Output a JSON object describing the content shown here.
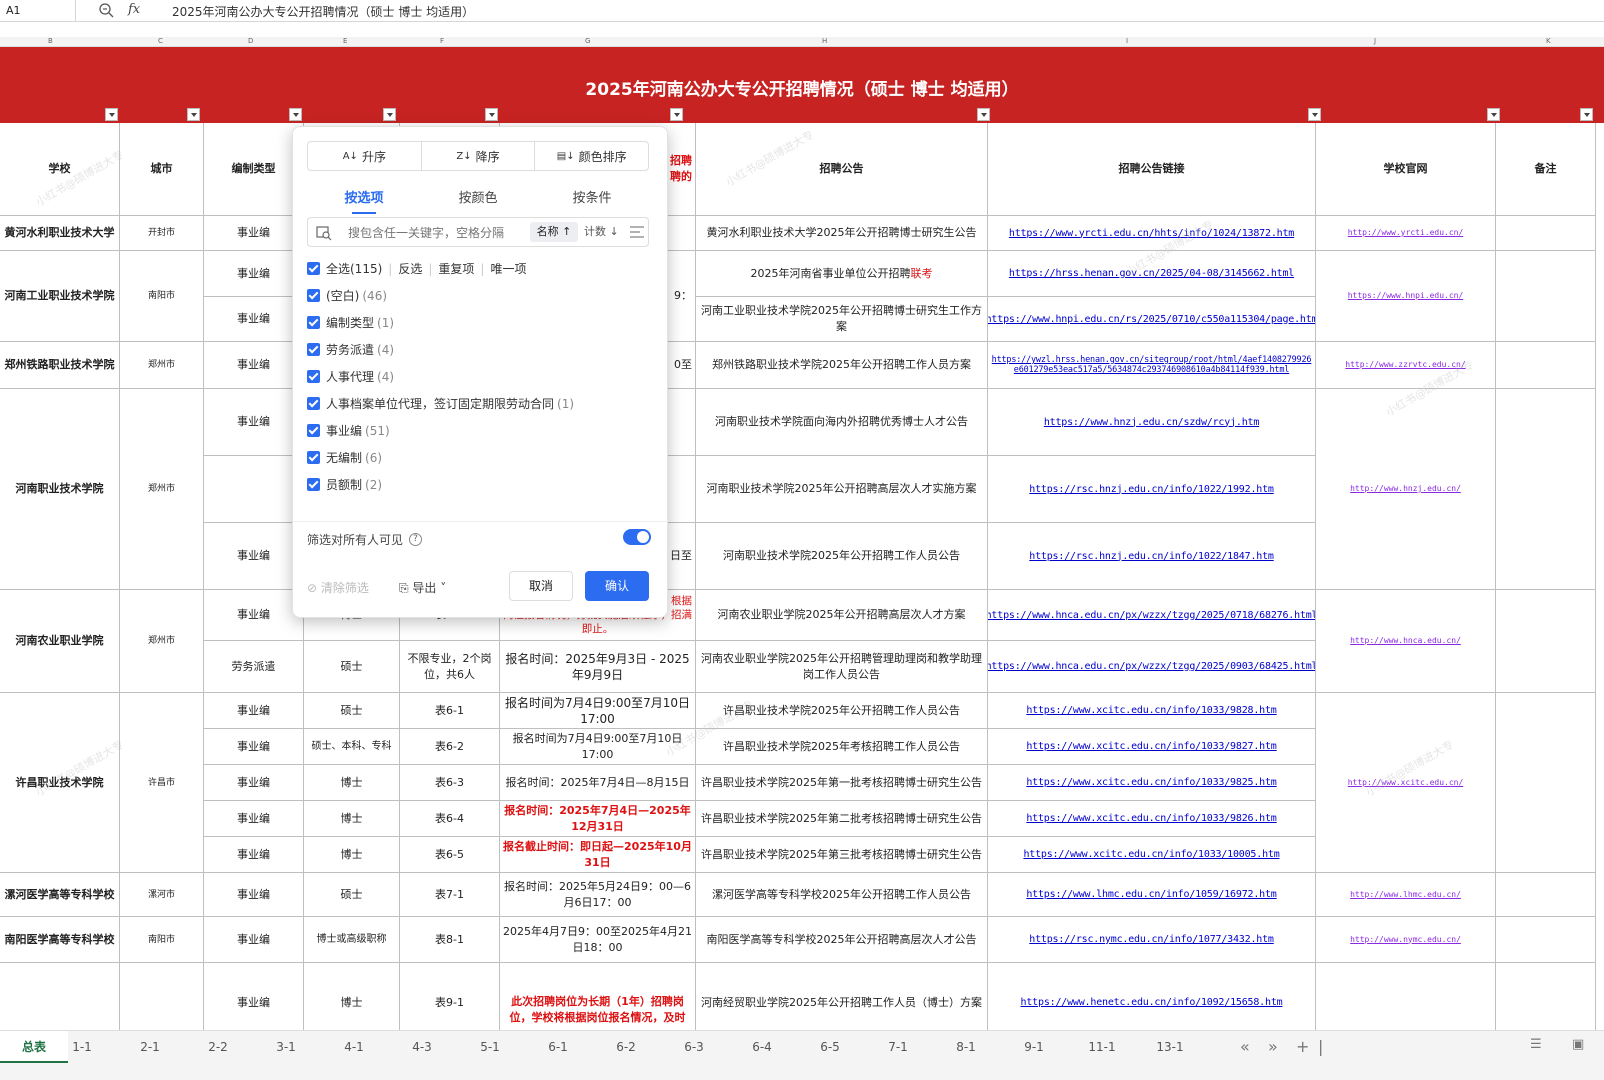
{
  "formula_bar": {
    "cell_ref": "A1",
    "fx_label": "fx",
    "content": "2025年河南公办大专公开招聘情况（硕士  博士 均适用）"
  },
  "column_letters": [
    "B",
    "C",
    "D",
    "E",
    "F",
    "G",
    "H",
    "I",
    "J",
    "K"
  ],
  "banner_title": "2025年河南公办大专公开招聘情况（硕士  博士 均适用）",
  "headers": {
    "school": "学校",
    "city": "城市",
    "type": "编制类型",
    "note_header_fragment": "招聘\n聘的",
    "announce": "招聘公告",
    "link": "招聘公告链接",
    "site": "学校官网",
    "remark": "备注"
  },
  "rows": [
    {
      "school": "黄河水利职业技术大学",
      "city": "开封市",
      "type": "事业编",
      "degree": "",
      "table": "",
      "note": "",
      "announce": "黄河水利职业技术大学2025年公开招聘博士研究生公告",
      "link": "https://www.yrcti.edu.cn/hhts/info/1024/13872.htm",
      "site": "http://www.yrcti.edu.cn/"
    },
    {
      "school": "河南工业职业技术学院",
      "city": "南阳市",
      "type": "事业编",
      "note": "9：",
      "announce": "2025年河南省事业单位公开招聘",
      "announce_red": "联考",
      "link": "https://hrss.henan.gov.cn/2025/04-08/3145662.html",
      "site": "https://www.hnpi.edu.cn/"
    },
    {
      "type": "事业编",
      "announce": "河南工业职业技术学院2025年公开招聘博士研究生工作方案",
      "link": "https://www.hnpi.edu.cn/rs/2025/0710/c550a115304/page.htm"
    },
    {
      "school": "郑州铁路职业技术学院",
      "city": "郑州市",
      "type": "事业编",
      "note": "0至",
      "announce": "郑州铁路职业技术学院2025年公开招聘工作人员方案",
      "link": "https://ywzl.hrss.henan.gov.cn/sitegroup/root/html/4aef1408279926e601279e53eac517a5/5634874c293746908610a4b84114f939.html",
      "site": "http://www.zzrvtc.edu.cn/"
    },
    {
      "school": "河南职业技术学院",
      "city": "郑州市",
      "type": "事业编",
      "announce": "河南职业技术学院面向海内外招聘优秀博士人才公告",
      "link": "https://www.hnzj.edu.cn/szdw/rcyj.htm",
      "site": "http://www.hnzj.edu.cn/"
    },
    {
      "type": "",
      "announce": "河南职业技术学院2025年公开招聘高层次人才实施方案",
      "link": "https://rsc.hnzj.edu.cn/info/1022/1992.htm"
    },
    {
      "type": "事业编",
      "note": "日至",
      "announce": "河南职业技术学院2025年公开招聘工作人员公告",
      "link": "https://rsc.hnzj.edu.cn/info/1022/1847.htm"
    },
    {
      "school": "河南农业职业学院",
      "city": "郑州市",
      "type": "事业编",
      "degree": "博士",
      "table": "表5-1",
      "note": "岗位报名情况，分批实施后续程序，招满即止。",
      "note_prefix": "根据",
      "announce": "河南农业职业学院2025年公开招聘高层次人才方案",
      "link": "https://www.hnca.edu.cn/px/wzzx/tzgg/2025/0718/68276.html",
      "site": "http://www.hnca.edu.cn/"
    },
    {
      "type": "劳务派遣",
      "degree": "硕士",
      "table": "不限专业，2个岗位，共6人",
      "note": "报名时间：2025年9月3日 - 2025年9月9日",
      "announce": "河南农业职业学院2025年公开招聘管理助理岗和教学助理岗工作人员公告",
      "link": "https://www.hnca.edu.cn/px/wzzx/tzgg/2025/0903/68425.html"
    },
    {
      "school": "许昌职业技术学院",
      "city": "许昌市",
      "type": "事业编",
      "degree": "硕士",
      "table": "表6-1",
      "note": "报名时间为7月4日9:00至7月10日17:00",
      "announce": "许昌职业技术学院2025年公开招聘工作人员公告",
      "link": "https://www.xcitc.edu.cn/info/1033/9828.htm",
      "site": "http://www.xcitc.edu.cn/"
    },
    {
      "type": "事业编",
      "degree": "硕士、本科、专科",
      "table": "表6-2",
      "note": "报名时间为7月4日9:00至7月10日17:00",
      "announce": "许昌职业技术学院2025年考核招聘工作人员公告",
      "link": "https://www.xcitc.edu.cn/info/1033/9827.htm"
    },
    {
      "type": "事业编",
      "degree": "博士",
      "table": "表6-3",
      "note": "报名时间：2025年7月4日—8月15日",
      "announce": "许昌职业技术学院2025年第一批考核招聘博士研究生公告",
      "link": "https://www.xcitc.edu.cn/info/1033/9825.htm"
    },
    {
      "type": "事业编",
      "degree": "博士",
      "table": "表6-4",
      "note": "报名时间：2025年7月4日—2025年12月31日",
      "red": true,
      "announce": "许昌职业技术学院2025年第二批考核招聘博士研究生公告",
      "link": "https://www.xcitc.edu.cn/info/1033/9826.htm"
    },
    {
      "type": "事业编",
      "degree": "博士",
      "table": "表6-5",
      "note": "报名截止时间：即日起—2025年10月31日",
      "red": true,
      "announce": "许昌职业技术学院2025年第三批考核招聘博士研究生公告",
      "link": "https://www.xcitc.edu.cn/info/1033/10005.htm"
    },
    {
      "school": "漯河医学高等专科学校",
      "city": "漯河市",
      "type": "事业编",
      "degree": "硕士",
      "table": "表7-1",
      "note": "报名时间：2025年5月24日9：00—6月6日17：00",
      "announce": "漯河医学高等专科学校2025年公开招聘工作人员公告",
      "link": "https://www.lhmc.edu.cn/info/1059/16972.htm",
      "site": "http://www.lhmc.edu.cn/"
    },
    {
      "school": "南阳医学高等专科学校",
      "city": "南阳市",
      "type": "事业编",
      "degree": "博士或高级职称",
      "table": "表8-1",
      "note": "2025年4月7日9：00至2025年4月21日18：00",
      "announce": "南阳医学高等专科学校2025年公开招聘高层次人才公告",
      "link": "https://rsc.nymc.edu.cn/info/1077/3432.htm",
      "site": "http://www.nymc.edu.cn/"
    },
    {
      "school": "",
      "city": "",
      "type": "事业编",
      "degree": "博士",
      "table": "表9-1",
      "note": "此次招聘岗位为长期（1年）招聘岗位，学校将根据岗位报名情况，及时",
      "red": true,
      "announce": "河南经贸职业学院2025年公开招聘工作人员（博士）方案",
      "link": "https://www.henetc.edu.cn/info/1092/15658.htm"
    }
  ],
  "filter_panel": {
    "sort_asc": "升序",
    "sort_desc": "降序",
    "sort_color": "颜色排序",
    "tab_items": "按选项",
    "tab_color": "按颜色",
    "tab_condition": "按条件",
    "search_placeholder": "搜包含任一关键字，空格分隔",
    "sort_by_name": "名称 ↑",
    "sort_by_count": "计数 ↓",
    "select_all": "全选(115)",
    "invert": "反选",
    "duplicates": "重复项",
    "unique": "唯一项",
    "options": [
      {
        "label": "(空白)",
        "count": "(46)"
      },
      {
        "label": "编制类型",
        "count": "(1)"
      },
      {
        "label": "劳务派遣",
        "count": "(4)"
      },
      {
        "label": "人事代理",
        "count": "(4)"
      },
      {
        "label": "人事档案单位代理，签订固定期限劳动合同",
        "count": "(1)"
      },
      {
        "label": "事业编",
        "count": "(51)"
      },
      {
        "label": "无编制",
        "count": "(6)"
      },
      {
        "label": "员额制",
        "count": "(2)"
      }
    ],
    "visible_to_all": "筛选对所有人可见",
    "visible_to_all_on": true,
    "clear": "清除筛选",
    "export": "导出",
    "cancel": "取消",
    "confirm": "确认"
  },
  "sheet_tabs": [
    "总表",
    "1-1",
    "2-1",
    "2-2",
    "3-1",
    "4-1",
    "4-3",
    "5-1",
    "6-1",
    "6-2",
    "6-3",
    "6-4",
    "6-5",
    "7-1",
    "8-1",
    "9-1",
    "11-1",
    "13-1"
  ],
  "active_sheet": "总表",
  "watermark": "小红书@硕博进大专"
}
